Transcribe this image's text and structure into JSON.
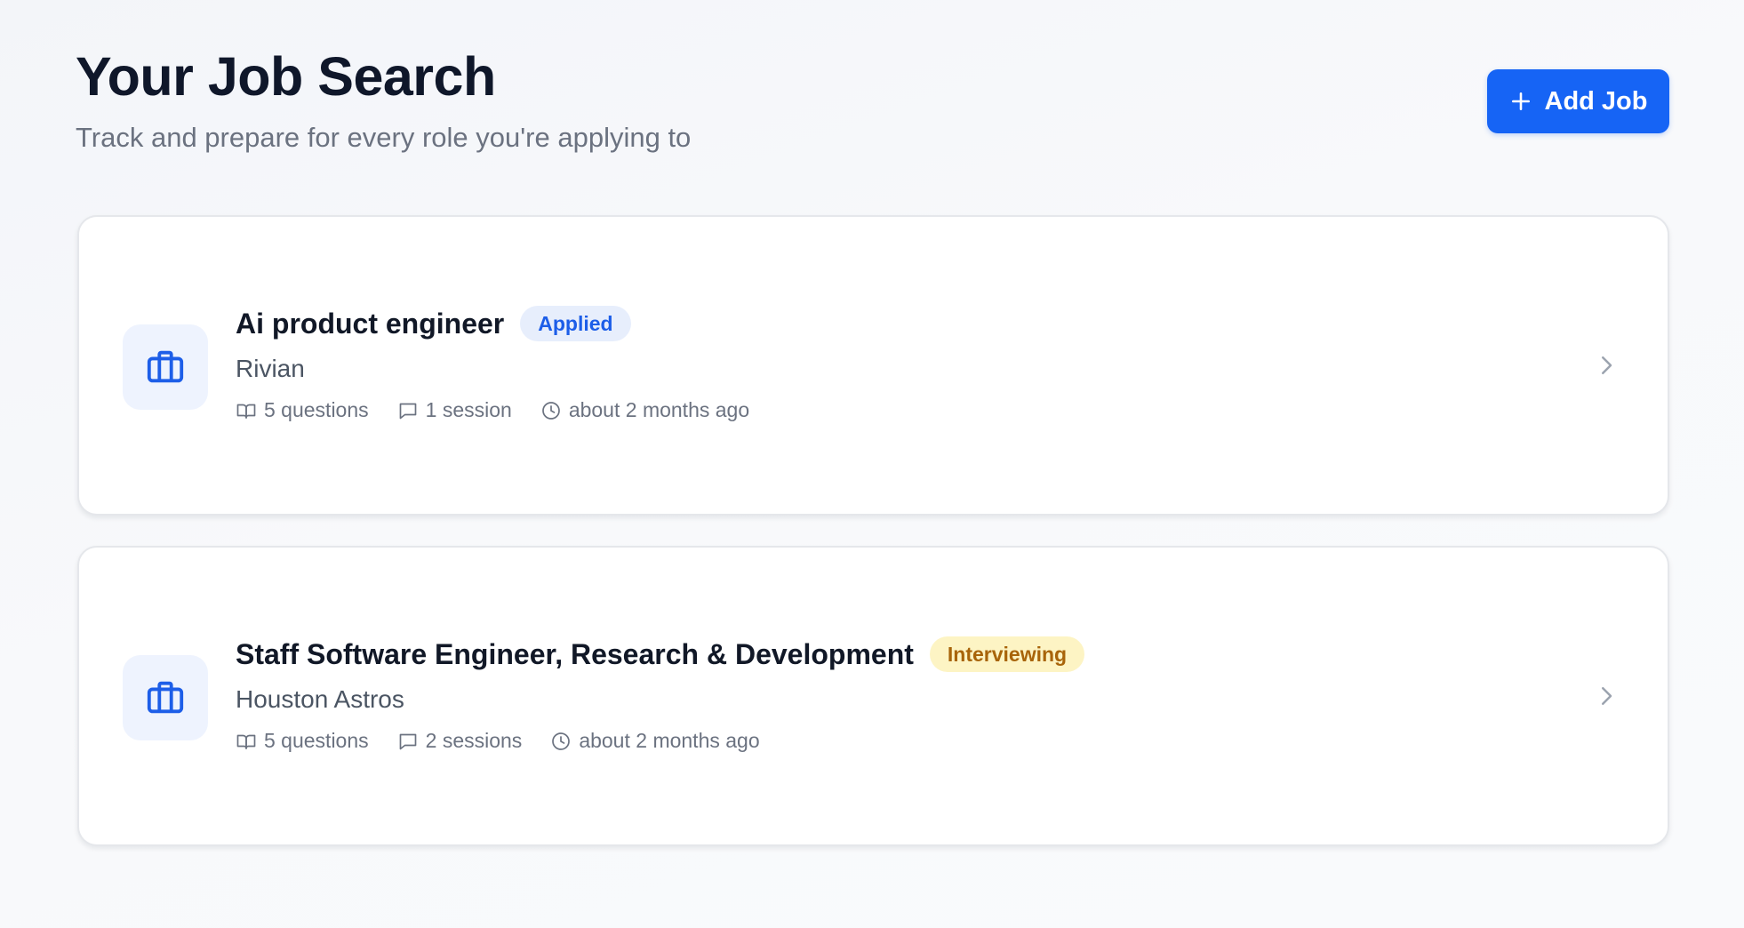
{
  "header": {
    "title": "Your Job Search",
    "subtitle": "Track and prepare for every role you're applying to",
    "add_button_label": "Add Job",
    "add_button_icon": "plus-icon"
  },
  "colors": {
    "primary": "#1664f5",
    "badge_applied_bg": "#e7eefc",
    "badge_applied_text": "#1d5ee8",
    "badge_interviewing_bg": "#fdf4c4",
    "badge_interviewing_text": "#a8640a"
  },
  "jobs": [
    {
      "title": "Ai product engineer",
      "status": "Applied",
      "company": "Rivian",
      "questions": "5 questions",
      "sessions": "1 session",
      "updated": "about 2 months ago",
      "icon": "briefcase-icon"
    },
    {
      "title": "Staff Software Engineer, Research & Development",
      "status": "Interviewing",
      "company": "Houston Astros",
      "questions": "5 questions",
      "sessions": "2 sessions",
      "updated": "about 2 months ago",
      "icon": "briefcase-icon"
    }
  ]
}
